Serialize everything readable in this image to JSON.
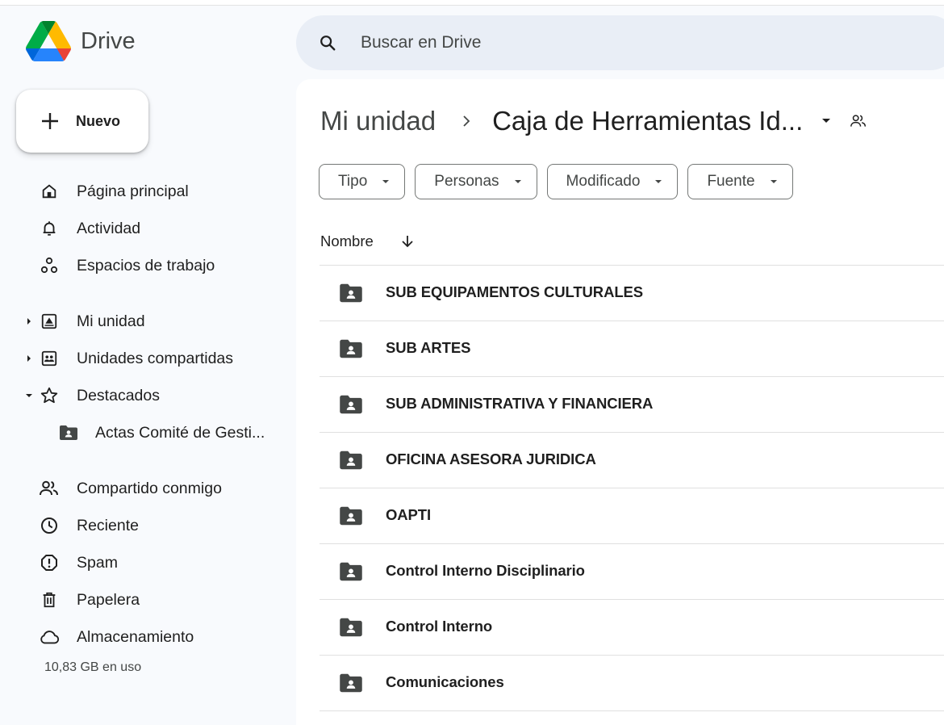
{
  "app": {
    "name": "Drive",
    "search_placeholder": "Buscar en Drive"
  },
  "sidebar": {
    "new_label": "Nuevo",
    "items": [
      {
        "label": "Página principal",
        "icon": "home-icon"
      },
      {
        "label": "Actividad",
        "icon": "bell-icon"
      },
      {
        "label": "Espacios de trabajo",
        "icon": "workspaces-icon"
      },
      {
        "label": "Mi unidad",
        "icon": "my-drive-icon"
      },
      {
        "label": "Unidades compartidas",
        "icon": "shared-drives-icon"
      },
      {
        "label": "Destacados",
        "icon": "star-icon"
      },
      {
        "label": "Actas Comité de Gesti...",
        "icon": "shared-folder-icon"
      },
      {
        "label": "Compartido conmigo",
        "icon": "people-icon"
      },
      {
        "label": "Reciente",
        "icon": "clock-icon"
      },
      {
        "label": "Spam",
        "icon": "spam-icon"
      },
      {
        "label": "Papelera",
        "icon": "trash-icon"
      },
      {
        "label": "Almacenamiento",
        "icon": "cloud-icon"
      }
    ],
    "storage_text": "10,83 GB en uso"
  },
  "main": {
    "breadcrumb_root": "Mi unidad",
    "breadcrumb_current": "Caja de Herramientas Id...",
    "filters": [
      {
        "label": "Tipo"
      },
      {
        "label": "Personas"
      },
      {
        "label": "Modificado"
      },
      {
        "label": "Fuente"
      }
    ],
    "column_name": "Nombre",
    "files": [
      {
        "name": "SUB EQUIPAMENTOS CULTURALES"
      },
      {
        "name": "SUB ARTES"
      },
      {
        "name": "SUB ADMINISTRATIVA Y FINANCIERA"
      },
      {
        "name": "OFICINA ASESORA JURIDICA"
      },
      {
        "name": "OAPTI"
      },
      {
        "name": "Control Interno Disciplinario"
      },
      {
        "name": "Control Interno"
      },
      {
        "name": "Comunicaciones"
      }
    ]
  }
}
